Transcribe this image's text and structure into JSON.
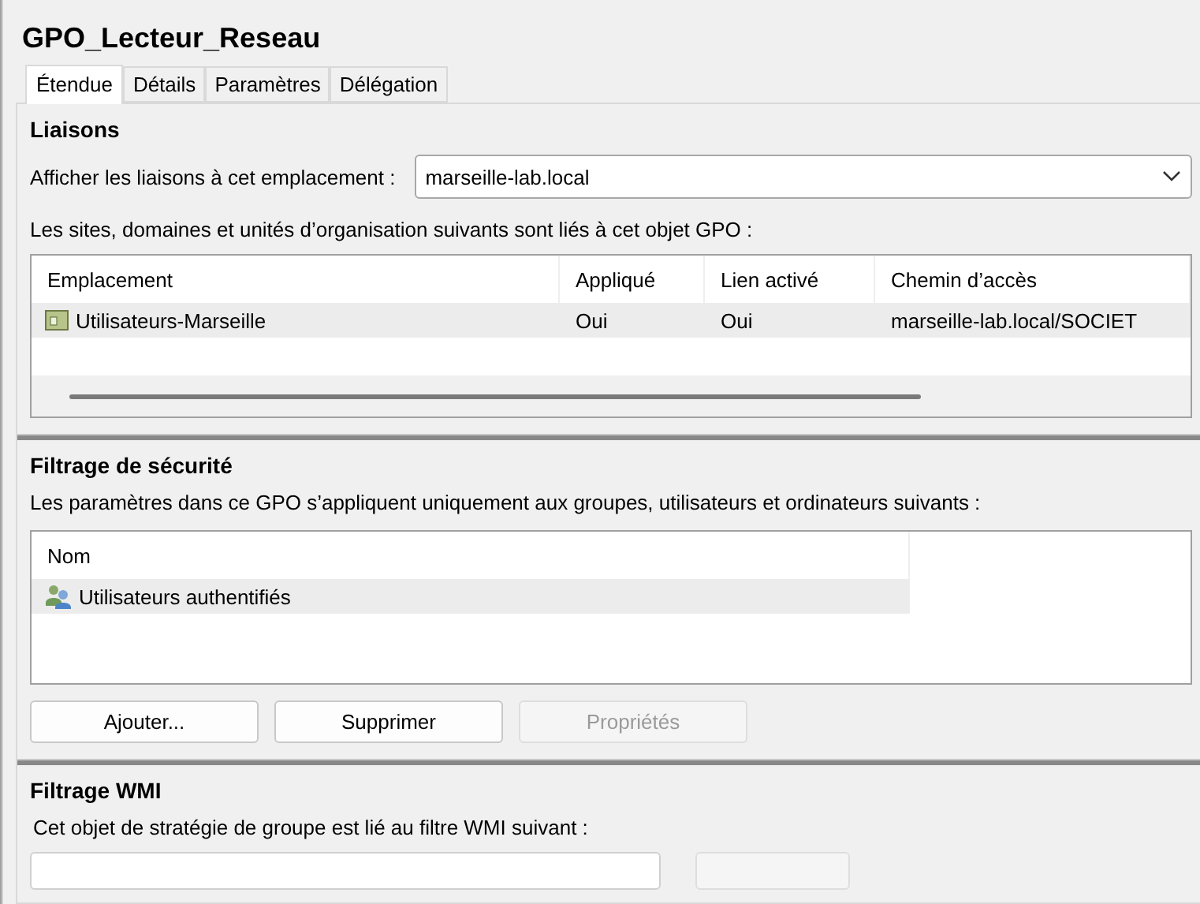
{
  "window": {
    "title": "GPO_Lecteur_Reseau"
  },
  "tabs": [
    {
      "label": "Étendue",
      "selected": true
    },
    {
      "label": "Détails",
      "selected": false
    },
    {
      "label": "Paramètres",
      "selected": false
    },
    {
      "label": "Délégation",
      "selected": false
    }
  ],
  "links": {
    "heading": "Liaisons",
    "location_label": "Afficher les liaisons à cet emplacement :",
    "location_value": "marseille-lab.local",
    "description": "Les sites, domaines et unités d’organisation suivants sont liés à cet objet GPO :",
    "columns": [
      "Emplacement",
      "Appliqué",
      "Lien activé",
      "Chemin d’accès"
    ],
    "rows": [
      {
        "location": "Utilisateurs-Marseille",
        "applied": "Oui",
        "link_enabled": "Oui",
        "path": "marseille-lab.local/SOCIET",
        "selected": true
      }
    ]
  },
  "security_filtering": {
    "heading": "Filtrage de sécurité",
    "description": "Les paramètres dans ce GPO s’appliquent uniquement aux groupes, utilisateurs et ordinateurs suivants :",
    "columns": [
      "Nom"
    ],
    "rows": [
      {
        "name": "Utilisateurs authentifiés",
        "selected": true
      }
    ],
    "buttons": [
      {
        "label": "Ajouter...",
        "disabled": false
      },
      {
        "label": "Supprimer",
        "disabled": false
      },
      {
        "label": "Propriétés",
        "disabled": true
      }
    ]
  },
  "wmi_filtering": {
    "heading": "Filtrage WMI",
    "description": "Cet objet de stratégie de groupe est lié au filtre WMI suivant :"
  }
}
